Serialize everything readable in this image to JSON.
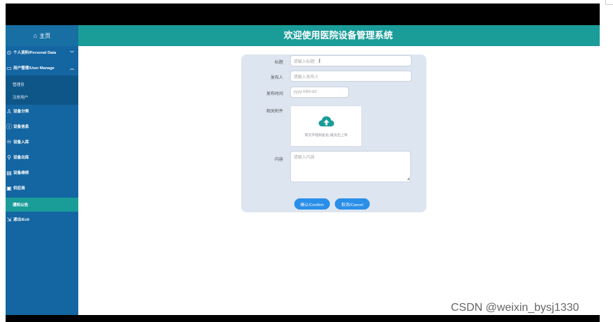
{
  "header": {
    "home_icon": "home-icon",
    "home_label": "主页",
    "title": "欢迎使用医院设备管理系统"
  },
  "sidebar": {
    "items": [
      {
        "icon": "person-icon",
        "label": "个人资料/Personal Data",
        "chevron": "chevron-down-icon"
      },
      {
        "icon": "monitor-icon",
        "label": "用户管理/User Manage",
        "chevron": "chevron-up-icon"
      },
      {
        "icon": "user-group-icon",
        "label": "设备分类"
      },
      {
        "icon": "info-icon",
        "label": "设备信息"
      },
      {
        "icon": "inbound-icon",
        "label": "设备入库"
      },
      {
        "icon": "search-icon",
        "label": "设备出库"
      },
      {
        "icon": "document-icon",
        "label": "设备维修"
      },
      {
        "icon": "supplier-icon",
        "label": "供应商"
      },
      {
        "label": "通知公告"
      },
      {
        "icon": "exit-icon",
        "label": "退出/Exit"
      }
    ],
    "subitems": [
      "管理员",
      "注册用户"
    ]
  },
  "form": {
    "title_label": "标题",
    "title_placeholder": "请输入标题",
    "publisher_label": "发布人",
    "publisher_placeholder": "请输入发布人",
    "time_label": "发布时间",
    "time_placeholder": "yyyy-MM-dd",
    "attachment_label": "相关附件",
    "upload_icon": "cloud-upload-icon",
    "upload_tip": "将文件拖到此处,或点击上传",
    "content_label": "内容",
    "content_placeholder": "请输入内容",
    "confirm_label": "确认/Confirm",
    "cancel_label": "取消/Cancel"
  },
  "colors": {
    "header": "#1a9c99",
    "sidebar": "#1466a2",
    "active_item": "#1a9c99",
    "button": "#2a8fe8"
  },
  "watermark": "CSDN @weixin_bysj1330"
}
